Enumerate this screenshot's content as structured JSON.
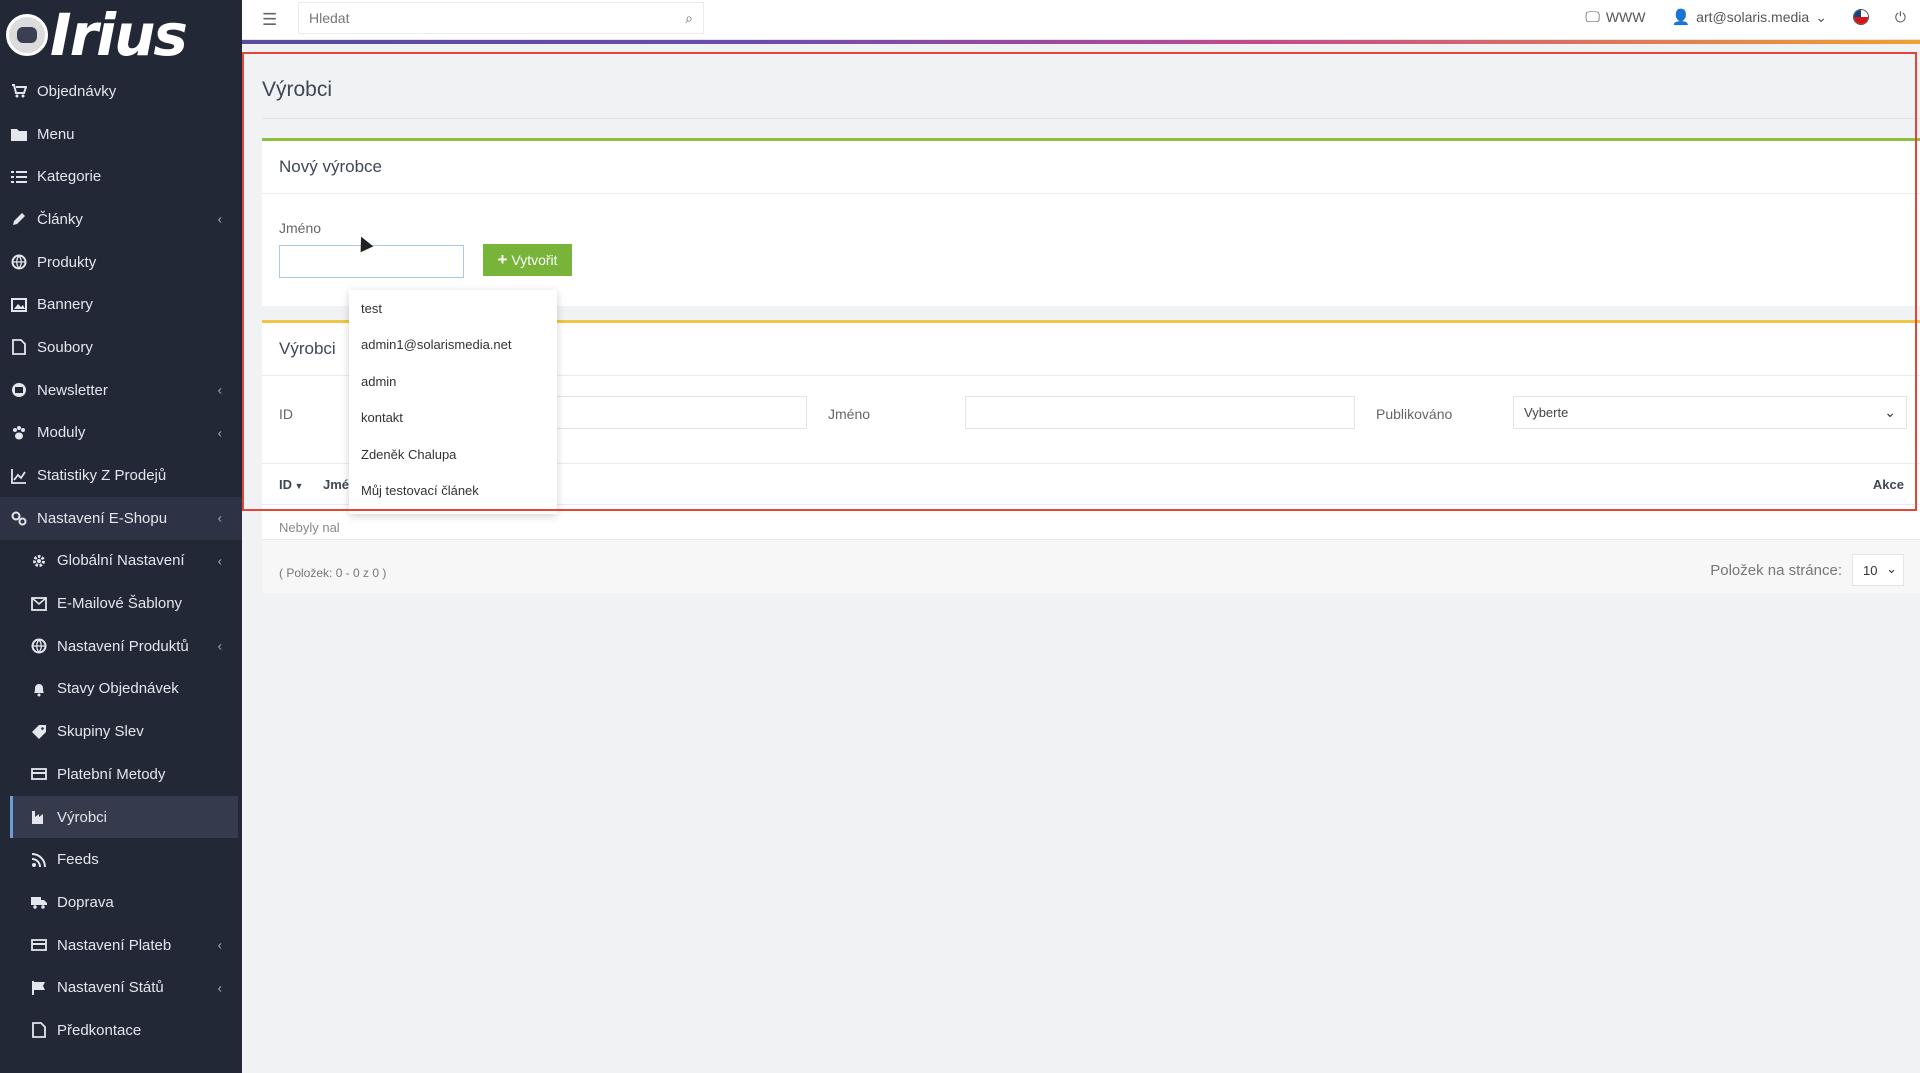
{
  "brand": {
    "logo_text": "Irius"
  },
  "topbar": {
    "search_placeholder": "Hledat",
    "www_label": "WWW",
    "user_label": "art@solaris.media"
  },
  "sidebar": {
    "items": [
      {
        "label": "Objednávky",
        "icon": "cart-icon"
      },
      {
        "label": "Menu",
        "icon": "folder-icon"
      },
      {
        "label": "Kategorie",
        "icon": "list-icon"
      },
      {
        "label": "Články",
        "icon": "pencil-icon",
        "expandable": true
      },
      {
        "label": "Produkty",
        "icon": "globe-icon"
      },
      {
        "label": "Bannery",
        "icon": "image-icon"
      },
      {
        "label": "Soubory",
        "icon": "file-icon"
      },
      {
        "label": "Newsletter",
        "icon": "newsletter-icon",
        "expandable": true
      },
      {
        "label": "Moduly",
        "icon": "paw-icon",
        "expandable": true
      },
      {
        "label": "Statistiky Z Prodejů",
        "icon": "chart-icon"
      },
      {
        "label": "Nastavení E-Shopu",
        "icon": "cogs-icon",
        "expandable": true
      }
    ],
    "subitems": [
      {
        "label": "Globální Nastavení",
        "icon": "gear-icon",
        "expandable": true
      },
      {
        "label": "E-Mailové Šablony",
        "icon": "mail-icon"
      },
      {
        "label": "Nastavení Produktů",
        "icon": "globe-icon",
        "expandable": true
      },
      {
        "label": "Stavy Objednávek",
        "icon": "bell-icon"
      },
      {
        "label": "Skupiny Slev",
        "icon": "tag-icon"
      },
      {
        "label": "Platební Metody",
        "icon": "card-icon"
      },
      {
        "label": "Výrobci",
        "icon": "factory-icon"
      },
      {
        "label": "Feeds",
        "icon": "feed-icon"
      },
      {
        "label": "Doprava",
        "icon": "truck-icon"
      },
      {
        "label": "Nastavení Plateb",
        "icon": "card-icon",
        "expandable": true
      },
      {
        "label": "Nastavení Států",
        "icon": "flag-icon",
        "expandable": true
      },
      {
        "label": "Předkontace",
        "icon": "file-icon"
      }
    ]
  },
  "page": {
    "title": "Výrobci",
    "new_panel": {
      "title": "Nový výrobce",
      "name_label": "Jméno",
      "create_button": "Vytvořit"
    },
    "list_panel": {
      "title": "Výrobci",
      "filter_id_label": "ID",
      "filter_name_label": "Jméno",
      "filter_published_label": "Publikováno",
      "filter_published_value": "Vyberte",
      "col_id": "ID",
      "col_name": "Jmé",
      "col_actions": "Akce",
      "empty_message": "Nebyly nal",
      "count_text": "( Položek: 0 - 0 z 0 )",
      "per_page_label": "Položek na stránce:",
      "per_page_value": "10"
    }
  },
  "autocomplete": [
    "test",
    "admin1@solarismedia.net",
    "admin",
    "kontakt",
    "Zdeněk Chalupa",
    "Můj testovací článek"
  ],
  "colors": {
    "sidebar_bg": "#232837",
    "create_button": "#78b33a",
    "panel_new_accent": "#8cbf3f",
    "panel_list_accent": "#f2c443",
    "annotation": "#e0463a"
  }
}
